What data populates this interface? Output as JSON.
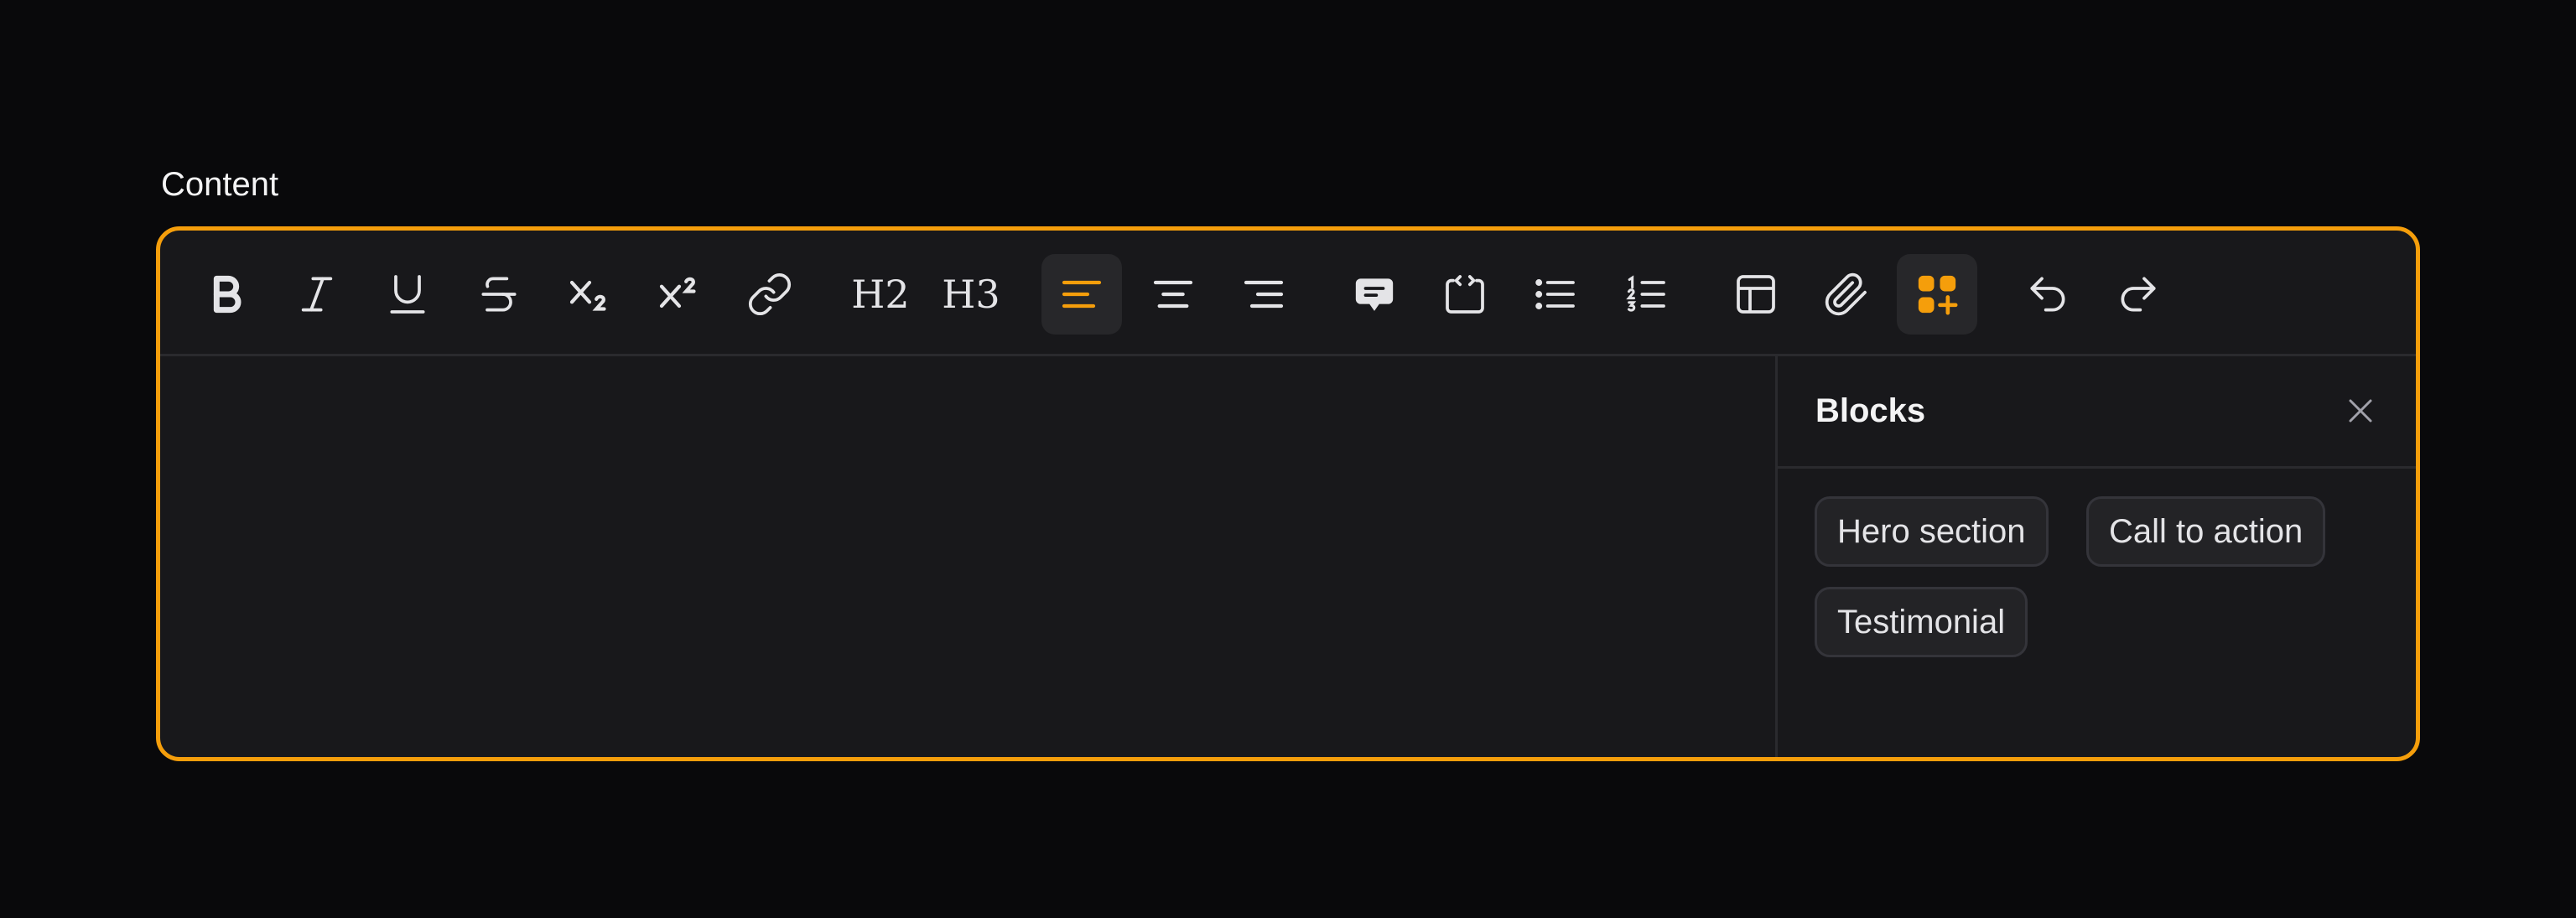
{
  "field": {
    "label": "Content"
  },
  "colors": {
    "accent": "#f59e0b",
    "background": "#09090b",
    "editor_bg": "#18181b",
    "border": "#2a2a2e"
  },
  "toolbar": {
    "buttons": [
      {
        "name": "bold",
        "icon": "bold-icon"
      },
      {
        "name": "italic",
        "icon": "italic-icon"
      },
      {
        "name": "underline",
        "icon": "underline-icon"
      },
      {
        "name": "strikethrough",
        "icon": "strikethrough-icon"
      },
      {
        "name": "subscript",
        "icon": "subscript-icon"
      },
      {
        "name": "superscript",
        "icon": "superscript-icon"
      },
      {
        "name": "link",
        "icon": "link-icon"
      },
      {
        "name": "heading-2",
        "icon": "heading-2-icon",
        "text": "H2"
      },
      {
        "name": "heading-3",
        "icon": "heading-3-icon",
        "text": "H3"
      },
      {
        "name": "align-left",
        "icon": "align-left-icon",
        "active": true
      },
      {
        "name": "align-center",
        "icon": "align-center-icon"
      },
      {
        "name": "align-right",
        "icon": "align-right-icon"
      },
      {
        "name": "blockquote",
        "icon": "speech-bubble-icon"
      },
      {
        "name": "code-block",
        "icon": "code-block-icon"
      },
      {
        "name": "bullet-list",
        "icon": "bullet-list-icon"
      },
      {
        "name": "ordered-list",
        "icon": "ordered-list-icon"
      },
      {
        "name": "table",
        "icon": "table-icon"
      },
      {
        "name": "attach-files",
        "icon": "paperclip-icon"
      },
      {
        "name": "custom-blocks",
        "icon": "blocks-plus-icon",
        "active": true
      },
      {
        "name": "undo",
        "icon": "undo-icon"
      },
      {
        "name": "redo",
        "icon": "redo-icon"
      }
    ]
  },
  "blocks_panel": {
    "title": "Blocks",
    "close_icon": "close-icon",
    "items": [
      {
        "label": "Hero section"
      },
      {
        "label": "Call to action"
      },
      {
        "label": "Testimonial"
      }
    ]
  }
}
